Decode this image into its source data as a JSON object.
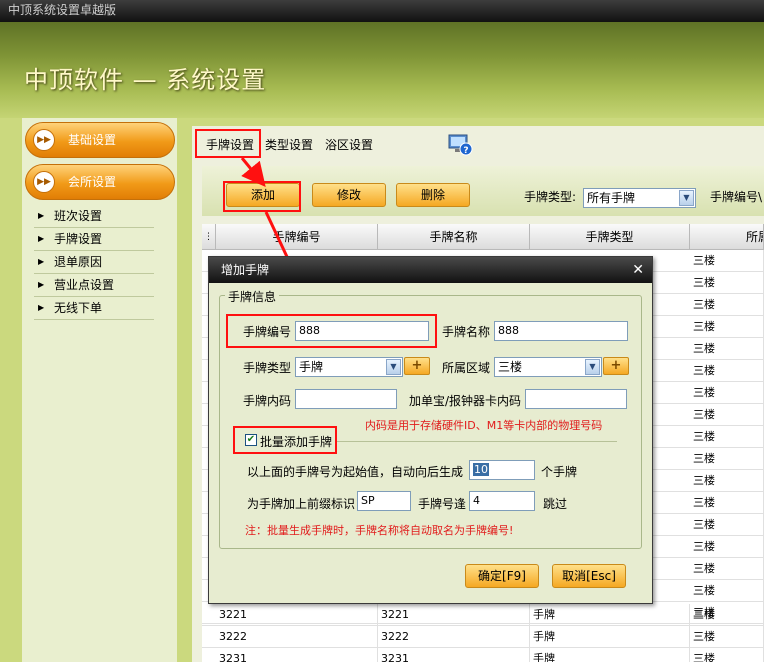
{
  "window": {
    "title": "中顶系统设置卓越版"
  },
  "banner": {
    "title": "中顶软件 — 系统设置"
  },
  "sidebar": {
    "main_items": [
      {
        "label": "基础设置"
      },
      {
        "label": "会所设置"
      }
    ],
    "sub_items": [
      {
        "label": "班次设置"
      },
      {
        "label": "手牌设置"
      },
      {
        "label": "退单原因"
      },
      {
        "label": "营业点设置"
      },
      {
        "label": "无线下单"
      }
    ]
  },
  "tabs": [
    {
      "label": "手牌设置",
      "active": true
    },
    {
      "label": "类型设置"
    },
    {
      "label": "浴区设置"
    }
  ],
  "toolbar": {
    "add_label": "添加",
    "edit_label": "修改",
    "delete_label": "删除",
    "type_filter_label": "手牌类型:",
    "type_filter_value": "所有手牌",
    "number_filter_label": "手牌编号\\"
  },
  "grid": {
    "columns": [
      "手牌编号",
      "手牌名称",
      "手牌类型",
      "所属"
    ],
    "right_column_values": [
      "三楼",
      "三楼",
      "三楼",
      "三楼",
      "三楼",
      "三楼",
      "三楼",
      "三楼",
      "三楼",
      "三楼",
      "三楼",
      "三楼",
      "三楼",
      "三楼",
      "三楼",
      "三楼",
      "三楼"
    ],
    "rows": [
      {
        "number": "3221",
        "name": "3221",
        "type": "手牌",
        "area": "三楼"
      },
      {
        "number": "3222",
        "name": "3222",
        "type": "手牌",
        "area": "三楼"
      },
      {
        "number": "3231",
        "name": "3231",
        "type": "手牌",
        "area": "三楼"
      }
    ]
  },
  "dialog": {
    "title": "增加手牌",
    "group_label": "手牌信息",
    "number_label": "手牌编号",
    "number_value": "888",
    "name_label": "手牌名称",
    "name_value": "888",
    "type_label": "手牌类型",
    "type_value": "手牌",
    "area_label": "所属区域",
    "area_value": "三楼",
    "inner_code_label": "手牌内码",
    "inner_code_value": "",
    "card_code_label": "加单宝/报钟器卡内码",
    "card_code_value": "",
    "inner_code_note": "内码是用于存储硬件ID、M1等卡内部的物理号码",
    "batch_checkbox_label": "批量添加手牌",
    "batch_checked": true,
    "batch_start_text": "以上面的手牌号为起始值，自动向后生成",
    "batch_count_value": "10",
    "batch_count_suffix": "个手牌",
    "prefix_label": "为手牌加上前缀标识",
    "prefix_value": "SP",
    "skip_label": "手牌号逢",
    "skip_value": "4",
    "skip_suffix": "跳过",
    "batch_note": "注：批量生成手牌时，手牌名称将自动取名为手牌编号!",
    "ok_label": "确定[F9]",
    "cancel_label": "取消[Esc]"
  },
  "colors": {
    "highlight_red": "#ff1010",
    "orange_button": "#f5a823",
    "note_red": "#e11b1b"
  }
}
